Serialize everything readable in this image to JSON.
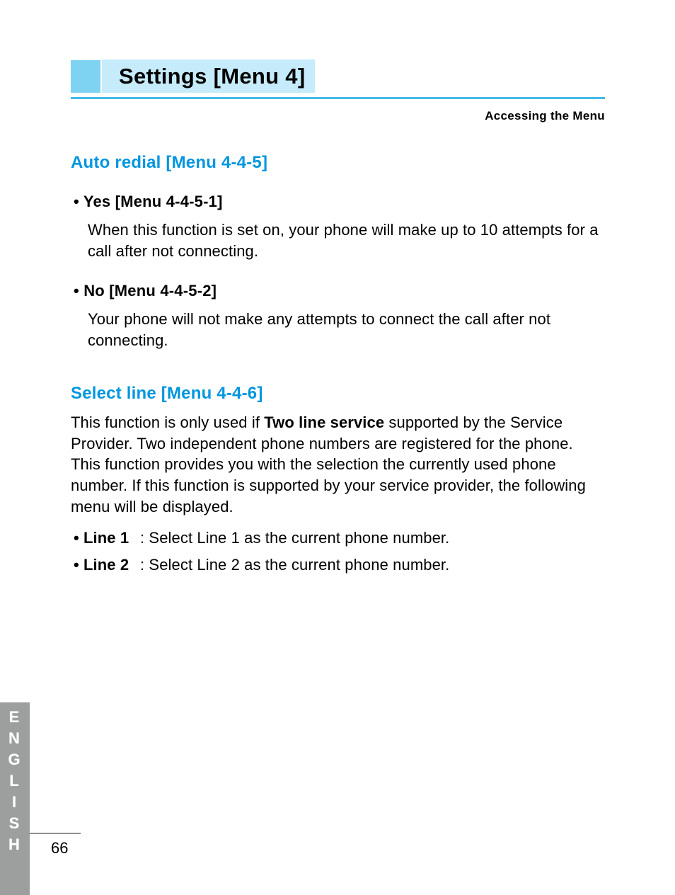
{
  "header": {
    "title": "Settings [Menu 4]",
    "subtitle": "Accessing the Menu"
  },
  "section1": {
    "heading": "Auto redial [Menu 4-4-5]",
    "yes": {
      "title": "Yes [Menu 4-4-5-1]",
      "body": "When this function is set on, your phone will make up to 10 attempts for a call after not connecting."
    },
    "no": {
      "title": "No [Menu 4-4-5-2]",
      "body": "Your phone will not make any attempts to connect the call after not connecting."
    }
  },
  "section2": {
    "heading": "Select line [Menu 4-4-6]",
    "body_pre": "This function is only used if ",
    "body_bold": "Two line service",
    "body_post": " supported by the Service Provider. Two independent phone numbers are registered for the phone. This function provides you with the selection the currently used phone number. If this function is supported by your service provider, the following menu will be displayed.",
    "line1": {
      "label": "Line 1",
      "desc": ": Select Line 1 as the current phone number."
    },
    "line2": {
      "label": "Line 2",
      "desc": ": Select Line 2 as the current phone number."
    }
  },
  "footer": {
    "language": "ENGLISH",
    "page": "66"
  }
}
